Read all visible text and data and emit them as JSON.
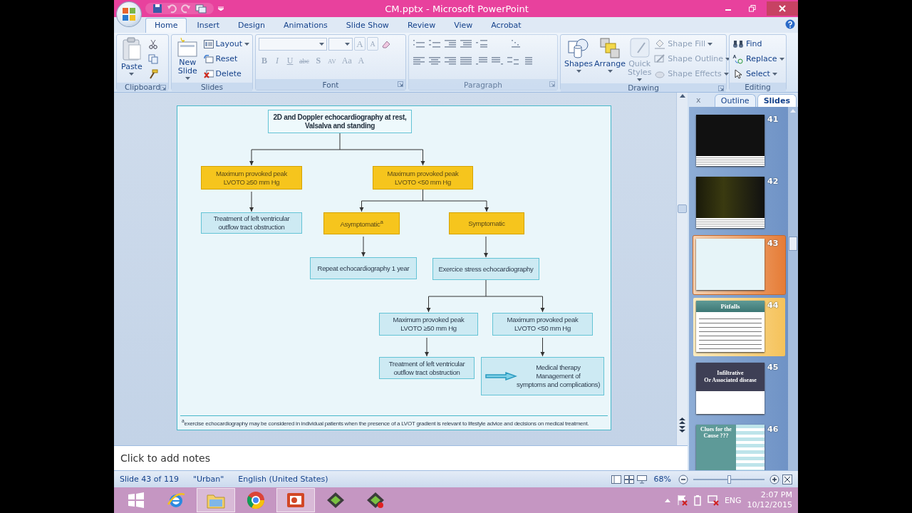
{
  "title_bar": {
    "title": "CM.pptx - Microsoft PowerPoint"
  },
  "ribbon_tabs": [
    {
      "label": "Home",
      "selected": true
    },
    {
      "label": "Insert",
      "selected": false
    },
    {
      "label": "Design",
      "selected": false
    },
    {
      "label": "Animations",
      "selected": false
    },
    {
      "label": "Slide Show",
      "selected": false
    },
    {
      "label": "Review",
      "selected": false
    },
    {
      "label": "View",
      "selected": false
    },
    {
      "label": "Acrobat",
      "selected": false
    }
  ],
  "ribbon": [
    {
      "kind": "clipboard",
      "label": "Clipboard",
      "items": [
        {
          "label": "Paste",
          "disabled": false
        }
      ]
    },
    {
      "kind": "slides",
      "label": "Slides",
      "items": [
        {
          "label": "New Slide",
          "disabled": false
        },
        {
          "label": "Layout",
          "disabled": false
        },
        {
          "label": "Reset",
          "disabled": false
        },
        {
          "label": "Delete",
          "disabled": false
        }
      ]
    },
    {
      "kind": "font",
      "label": "Font",
      "disabled": true,
      "size_buttons": [
        "A",
        "A"
      ],
      "format_buttons": [
        "B",
        "I",
        "U",
        "abc",
        "S",
        "AV",
        "Aa",
        "A"
      ]
    },
    {
      "kind": "paragraph",
      "label": "Paragraph",
      "disabled": true
    },
    {
      "kind": "drawing",
      "label": "Drawing",
      "items": [
        {
          "label": "Shapes",
          "disabled": false
        },
        {
          "label": "Arrange",
          "disabled": false
        },
        {
          "label": "Quick Styles",
          "disabled": true
        },
        {
          "label": "Shape Fill",
          "disabled": true
        },
        {
          "label": "Shape Outline",
          "disabled": true
        },
        {
          "label": "Shape Effects",
          "disabled": true
        }
      ]
    },
    {
      "kind": "editing",
      "label": "Editing",
      "items": [
        {
          "label": "Find",
          "disabled": false
        },
        {
          "label": "Replace",
          "disabled": false
        },
        {
          "label": "Select",
          "disabled": false
        }
      ]
    }
  ],
  "slide": {
    "flowchart": [
      {
        "kind": "action",
        "text": "2D and Doppler echocardiography at rest,\nValsalva and standing",
        "children": [
          {
            "kind": "decision",
            "text": "Maximum provoked peak\nLVOTO ≥50 mm Hg",
            "children": [
              {
                "kind": "action",
                "text": "Treatment of left ventricular\noutflow tract obstruction"
              }
            ]
          },
          {
            "kind": "decision",
            "text": "Maximum provoked peak\nLVOTO <50 mm Hg",
            "children": [
              {
                "kind": "decision",
                "text": "Asymptomatic$^{a}$",
                "children": [
                  {
                    "kind": "action",
                    "text": "Repeat echocardiography 1 year"
                  }
                ]
              },
              {
                "kind": "decision",
                "text": "Symptomatic",
                "children": [
                  {
                    "kind": "action",
                    "text": "Exercice stress echocardiography",
                    "children": [
                      {
                        "kind": "action",
                        "text": "Maximum provoked peak\nLVOTO ≥50 mm Hg",
                        "children": [
                          {
                            "kind": "action",
                            "text": "Treatment of left ventricular\noutflow tract obstruction"
                          }
                        ]
                      },
                      {
                        "kind": "action",
                        "text": "Maximum provoked peak\nLVOTO <50 mm Hg",
                        "children": [
                          {
                            "kind": "action",
                            "text": "Medical therapy\nManagement of\nsymptoms and complications)"
                          }
                        ]
                      }
                    ]
                  }
                ]
              }
            ]
          }
        ]
      }
    ],
    "footnote": "$^{a}$exercise echocardiography may be considered in individual patients when the presence of a LVOT gradient is relevant to lifestyle advice and decisions on medical treatment."
  },
  "notes": {
    "placeholder": "Click to add notes"
  },
  "slides_pane": {
    "tabs": [
      {
        "label": "Outline",
        "selected": false
      },
      {
        "label": "Slides",
        "selected": true
      }
    ],
    "close": "x",
    "slides": [
      {
        "number": "41",
        "kind": "image",
        "selected": false,
        "hovered": false
      },
      {
        "number": "42",
        "kind": "image",
        "selected": false,
        "hovered": false
      },
      {
        "number": "43",
        "kind": "diagram",
        "selected": true,
        "hovered": false
      },
      {
        "number": "44",
        "kind": "bullets",
        "title": "Pitfalls",
        "selected": false,
        "hovered": true
      },
      {
        "number": "45",
        "kind": "title",
        "title": "Infiltrative\nOr Associated disease",
        "selected": false,
        "hovered": false
      },
      {
        "number": "46",
        "kind": "table",
        "title": "Clues for the\nCause ???",
        "selected": false,
        "hovered": false
      }
    ]
  },
  "status_bar": {
    "slide": "Slide 43 of 119",
    "theme": "\"Urban\"",
    "language": "English (United States)",
    "zoom": "68%",
    "zoom_slider": {
      "level": 0.5
    }
  },
  "taskbar": {
    "apps": [
      {
        "active": false
      },
      {
        "active": true
      },
      {
        "active": false
      },
      {
        "active": true
      },
      {
        "active": false
      },
      {
        "active": false
      }
    ],
    "language": "ENG",
    "time": "2:07 PM",
    "date": "10/12/2015"
  }
}
